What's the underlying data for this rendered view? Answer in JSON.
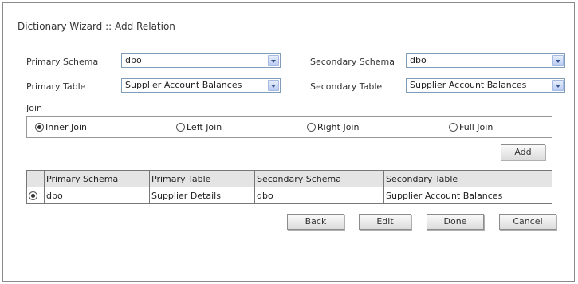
{
  "title": "Dictionary Wizard :: Add Relation",
  "primary_schema": {
    "label": "Primary Schema",
    "value": "dbo"
  },
  "secondary_schema": {
    "label": "Secondary Schema",
    "value": "dbo"
  },
  "primary_table": {
    "label": "Primary Table",
    "value": "Supplier Account Balances"
  },
  "secondary_table": {
    "label": "Secondary Table",
    "value": "Supplier Account Balances"
  },
  "join": {
    "label": "Join",
    "options": [
      "Inner Join",
      "Left Join",
      "Right Join",
      "Full Join"
    ],
    "selected": "Inner Join"
  },
  "add_label": "Add",
  "relations_table": {
    "headers": [
      "Primary Schema",
      "Primary Table",
      "Secondary Schema",
      "Secondary Table"
    ],
    "rows": [
      {
        "selected": true,
        "cells": [
          "dbo",
          "Supplier Details",
          "dbo",
          "Supplier Account Balances"
        ]
      }
    ]
  },
  "buttons": {
    "back": "Back",
    "edit": "Edit",
    "done": "Done",
    "cancel": "Cancel"
  }
}
